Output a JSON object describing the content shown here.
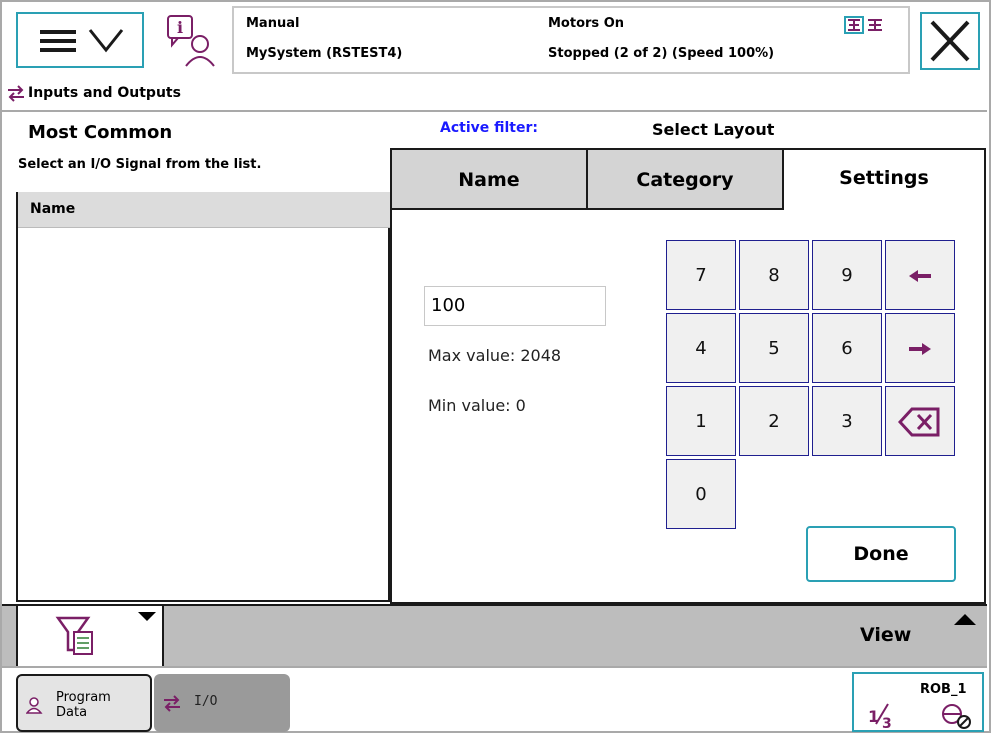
{
  "status": {
    "mode": "Manual",
    "system": "MySystem (RSTEST4)",
    "motors": "Motors On",
    "state": "Stopped (2 of 2) (Speed 100%)"
  },
  "app": {
    "title": "Inputs and Outputs"
  },
  "left": {
    "title": "Most Common",
    "subtitle": "Select an I/O Signal from the list.",
    "column_header": "Name"
  },
  "filter": {
    "active_label": "Active filter:",
    "layout_label": "Select Layout"
  },
  "tabs": {
    "name": "Name",
    "category": "Category",
    "settings": "Settings"
  },
  "settings": {
    "value": "100",
    "max_label": "Max value: 2048",
    "min_label": "Min value: 0"
  },
  "keypad": {
    "k7": "7",
    "k8": "8",
    "k9": "9",
    "k4": "4",
    "k5": "5",
    "k6": "6",
    "k1": "1",
    "k2": "2",
    "k3": "3",
    "k0": "0",
    "done": "Done"
  },
  "cmdbar": {
    "view": "View"
  },
  "taskbar": {
    "program_data": "Program Data",
    "io": "I/O",
    "rob": "ROB_1"
  },
  "colors": {
    "accent": "#2aa0b4",
    "active_filter": "#1a1aff",
    "key_border": "#1f1f8f",
    "icon_purple": "#7a1f66"
  }
}
